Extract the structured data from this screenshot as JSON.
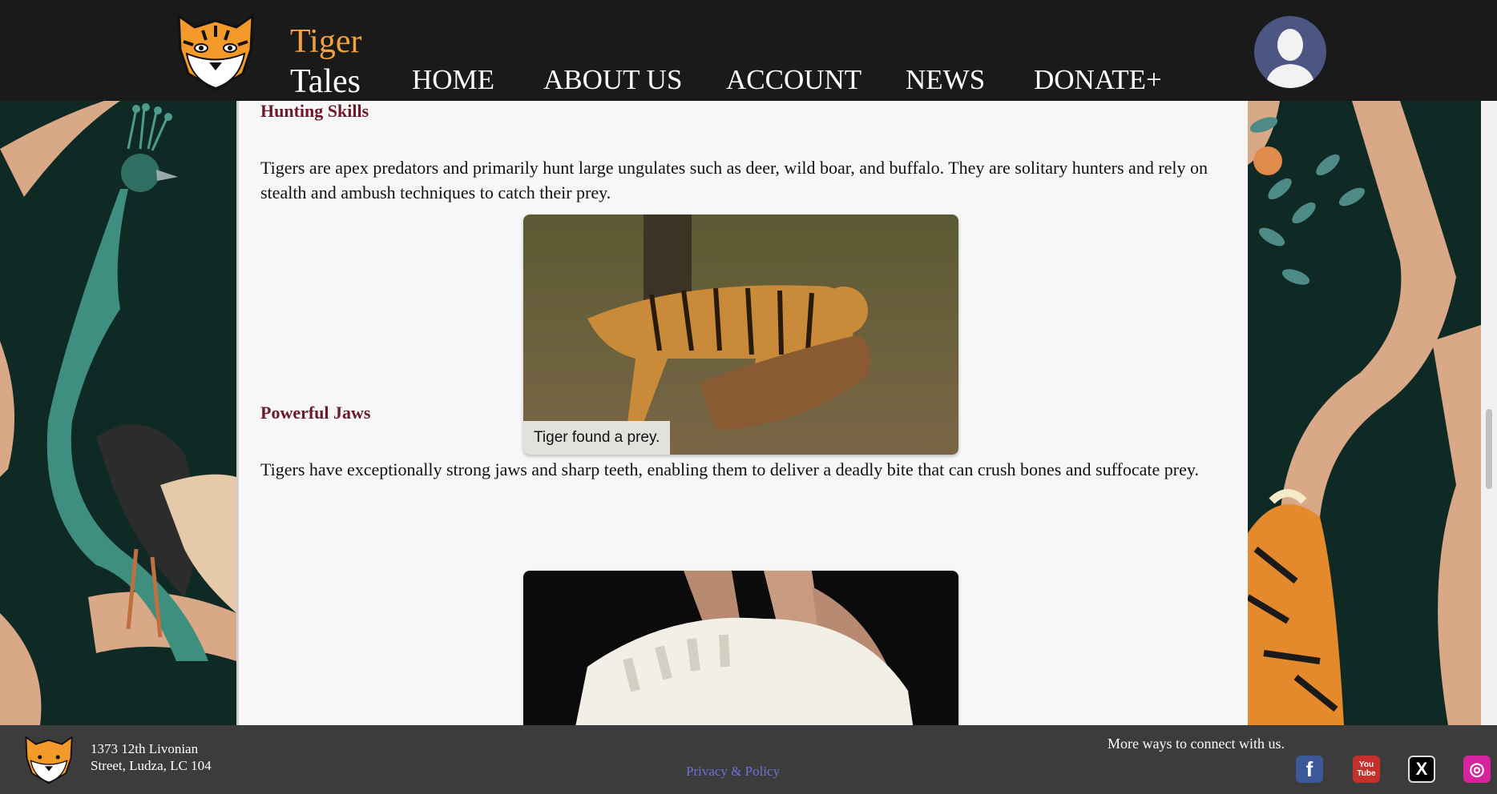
{
  "header": {
    "brand_top": "Tiger",
    "brand_bottom": "Tales",
    "nav": [
      "HOME",
      "ABOUT US",
      "ACCOUNT",
      "NEWS",
      "DONATE+"
    ]
  },
  "content": {
    "sections": [
      {
        "heading": "Hunting Skills",
        "text": "Tigers are apex predators and primarily hunt large ungulates such as deer, wild boar, and buffalo. They are solitary hunters and rely on stealth and ambush techniques to catch their prey.",
        "caption": "Tiger found a prey."
      },
      {
        "heading": "Powerful Jaws",
        "text": "Tigers have exceptionally strong jaws and sharp teeth, enabling them to deliver a deadly bite that can crush bones and suffocate prey."
      }
    ]
  },
  "footer": {
    "address_line1": "1373 12th Livonian",
    "address_line2": "Street, Ludza, LC 104",
    "privacy": "Privacy & Policy",
    "connect": "More ways to connect with us.",
    "social": [
      {
        "icon": "facebook-icon",
        "glyph": "f",
        "color": "#3b5998"
      },
      {
        "icon": "youtube-icon",
        "glyph": "You Tube",
        "color": "#c4302b"
      },
      {
        "icon": "x-icon",
        "glyph": "X",
        "color": "#000000"
      },
      {
        "icon": "instagram-icon",
        "glyph": "◎",
        "color": "#d6249f"
      }
    ]
  }
}
